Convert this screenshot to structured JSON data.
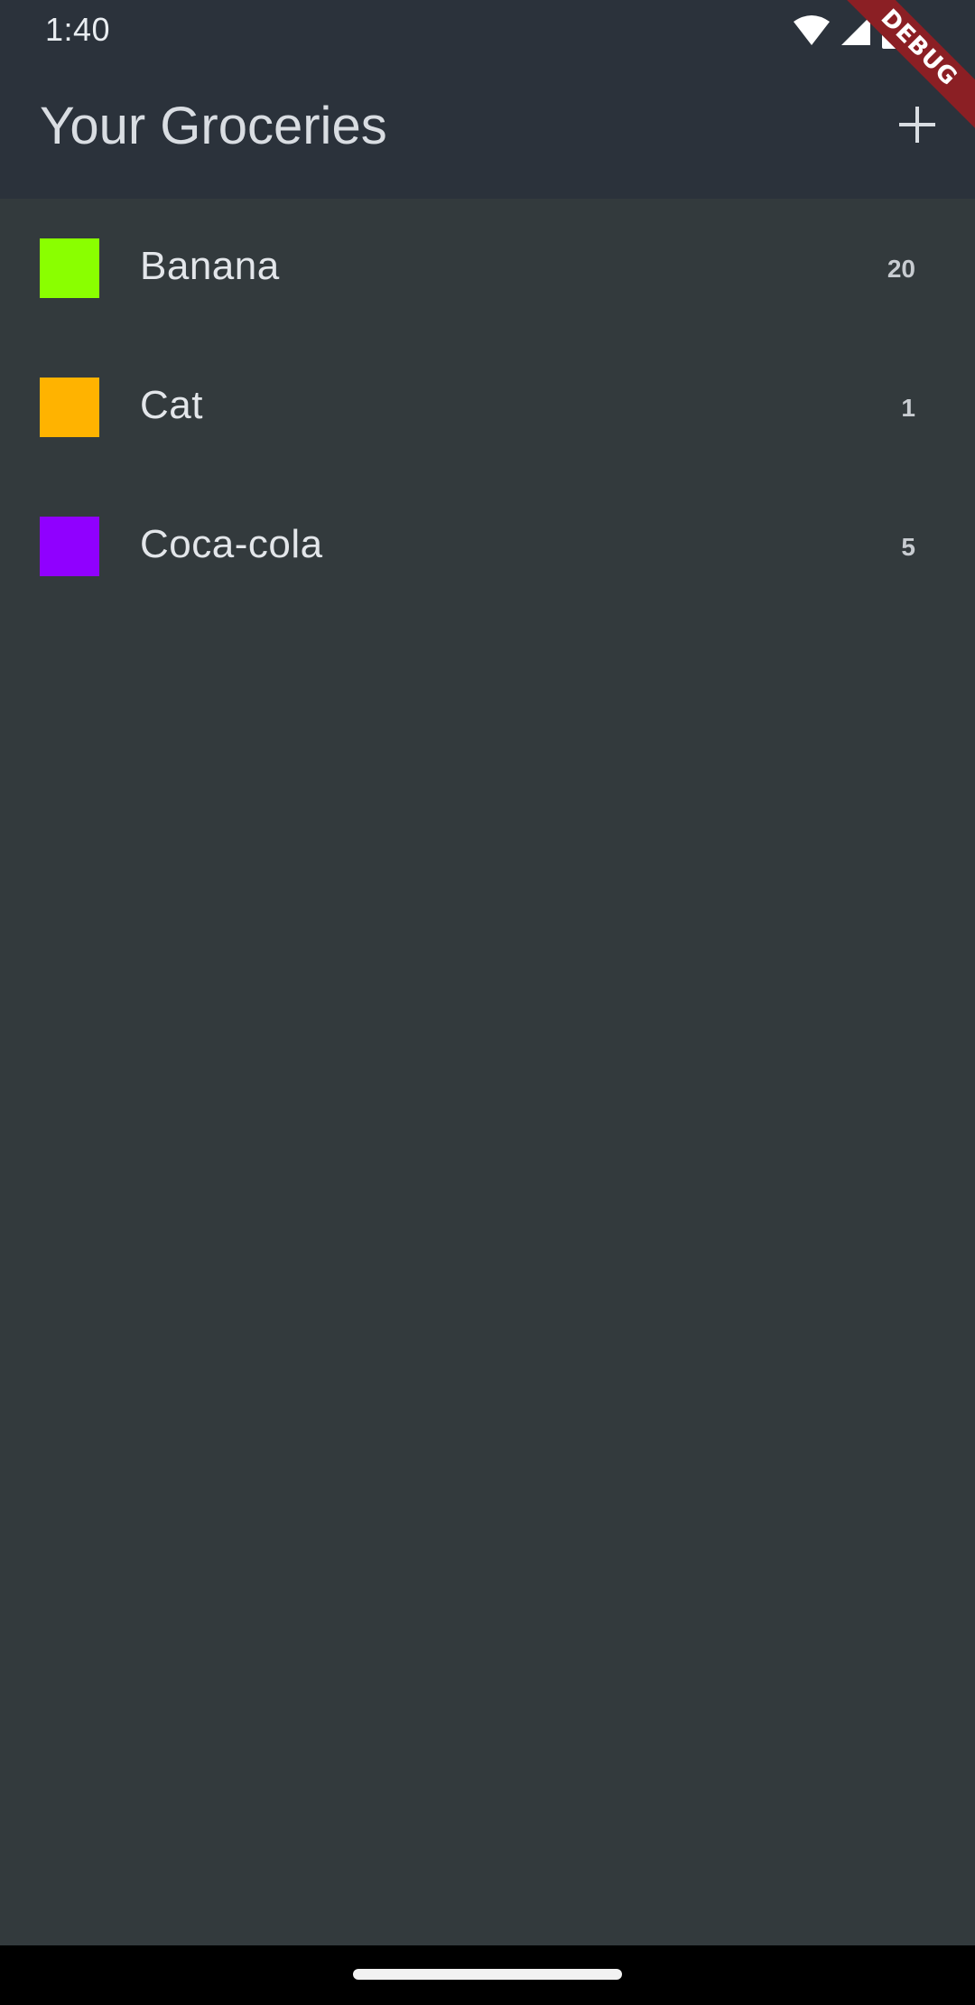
{
  "status_bar": {
    "time": "1:40",
    "icons": [
      "wifi-icon",
      "cellular-signal-icon",
      "battery-icon"
    ]
  },
  "app_bar": {
    "title": "Your Groceries",
    "add_icon": "plus-icon"
  },
  "debug_banner": {
    "label": "DEBUG"
  },
  "groceries": [
    {
      "name": "Banana",
      "quantity": "20",
      "color": "#8aff00"
    },
    {
      "name": "Cat",
      "quantity": "1",
      "color": "#ffb300"
    },
    {
      "name": "Coca-cola",
      "quantity": "5",
      "color": "#9000ff"
    }
  ],
  "colors": {
    "app_bar_background": "#2b323b",
    "body_background": "#333a3d",
    "text_primary": "#e3e6ea",
    "debug_banner": "#8b1f24"
  }
}
